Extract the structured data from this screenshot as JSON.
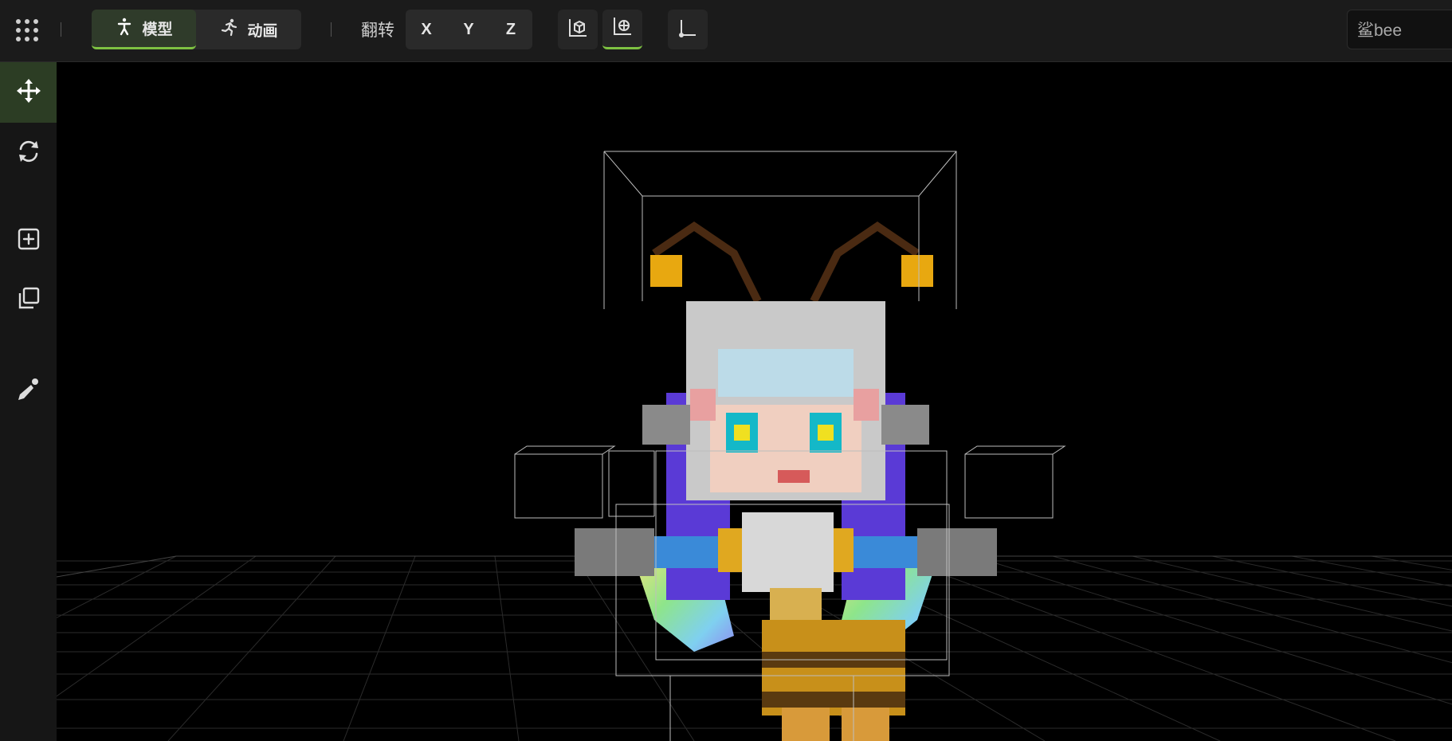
{
  "toolbar": {
    "menu_icon": "grid-menu-icon",
    "mode_tabs": [
      {
        "label": "模型",
        "icon": "person-icon",
        "active": true
      },
      {
        "label": "动画",
        "icon": "running-icon",
        "active": false
      }
    ],
    "flip_label": "翻转",
    "flip_axes": [
      "X",
      "Y",
      "Z"
    ],
    "view_buttons": [
      {
        "icon": "bounding-box-icon",
        "active": false
      },
      {
        "icon": "bounding-box-grid-icon",
        "active": true
      },
      {
        "icon": "axis-corner-icon",
        "active": false
      }
    ],
    "model_name": "鲨bee"
  },
  "sidebar": {
    "tools": [
      {
        "icon": "move-arrows-icon",
        "active": true
      },
      {
        "icon": "rotate-icon",
        "active": false
      },
      {
        "icon": "add-box-icon",
        "active": false
      },
      {
        "icon": "duplicate-icon",
        "active": false
      },
      {
        "icon": "paint-brush-icon",
        "active": false
      }
    ]
  },
  "colors": {
    "accent": "#7ec242",
    "toolbar_bg": "#1b1b1b",
    "sidebar_bg": "#161616",
    "viewport_bg": "#000000"
  }
}
